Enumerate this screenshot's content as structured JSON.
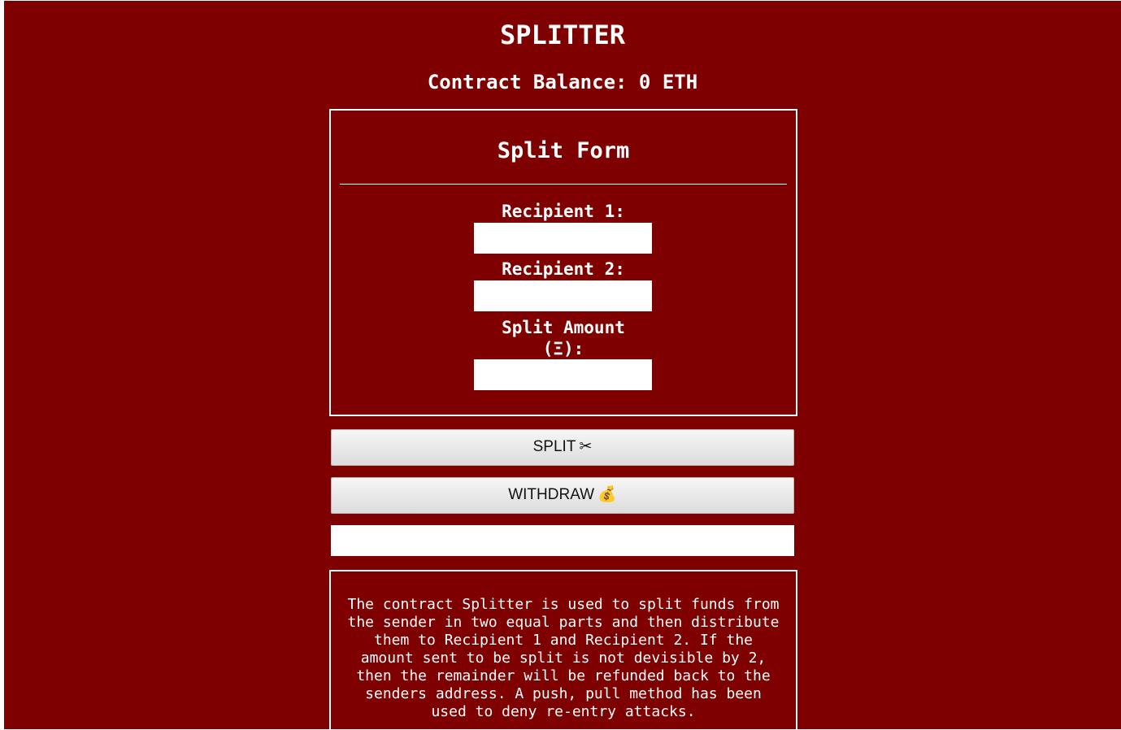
{
  "header": {
    "title": "SPLITTER",
    "balance_text": "Contract Balance: 0 ETH"
  },
  "form": {
    "title": "Split Form",
    "recipient1_label": "Recipient 1:",
    "recipient1_value": "",
    "recipient2_label": "Recipient 2:",
    "recipient2_value": "",
    "amount_label_line1": "Split Amount",
    "amount_label_line2": "(Ξ):",
    "amount_value": ""
  },
  "actions": {
    "split_label": "SPLIT",
    "split_icon": "✂",
    "split_icon_name": "scissors-icon",
    "withdraw_label": "WITHDRAW",
    "withdraw_icon": "💰",
    "withdraw_icon_name": "money-bag-icon"
  },
  "status": {
    "value": ""
  },
  "description": {
    "text": "The contract Splitter is used to split funds from\nthe sender in two equal parts and then distribute\nthem to Recipient 1 and Recipient 2. If the\namount sent to be split is not devisible by 2,\nthen the remainder will be refunded back to the\nsenders address. A push, pull method has been\nused to deny re-entry attacks."
  },
  "colors": {
    "background": "#7f0000",
    "text": "#ffffff",
    "button": "#e8e8e8"
  }
}
